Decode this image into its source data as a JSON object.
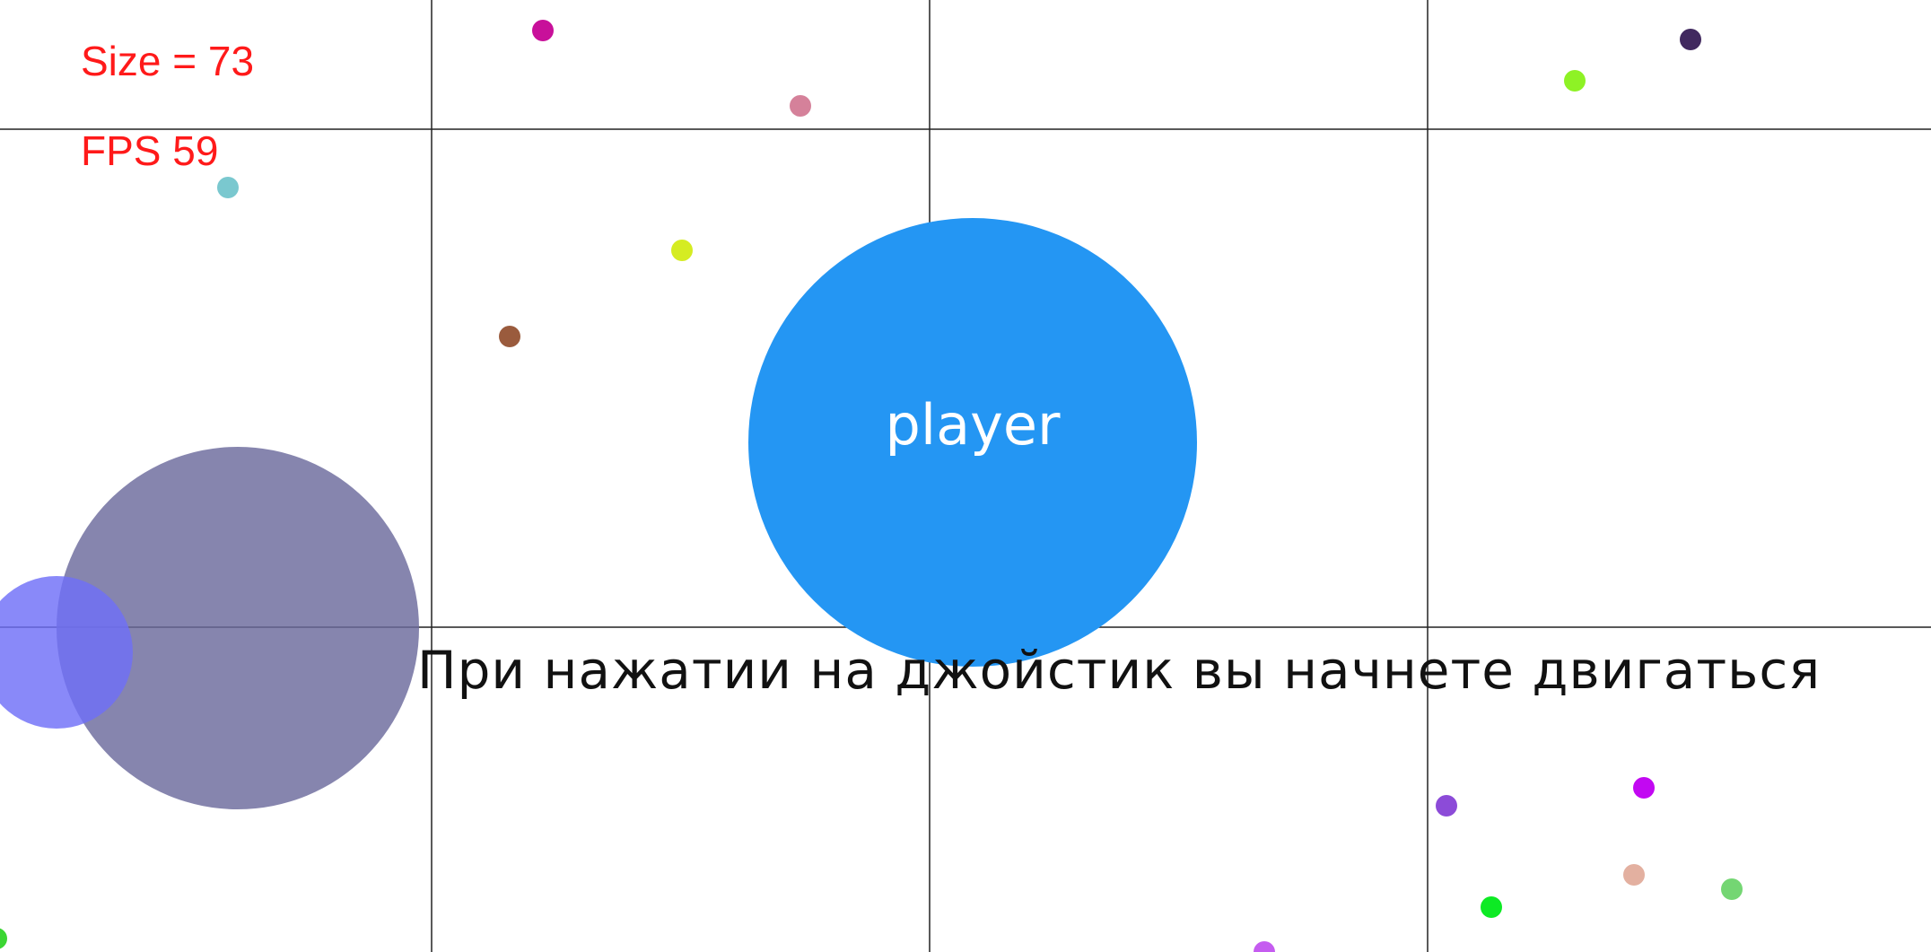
{
  "hud": {
    "size_text": "Size = 73",
    "fps_text": "FPS  59"
  },
  "player": {
    "label": "player",
    "color": "#2496f3",
    "label_color": "#ffffff"
  },
  "hint": {
    "text": "При нажатии на джойстик вы начнете двигаться"
  },
  "colors": {
    "background": "#ffffff",
    "grid_line": "#222222",
    "hud_text": "#ff1a1a",
    "enemy_large": "#6b6a9c",
    "enemy_small": "#6f6ff8"
  },
  "food_colors": [
    "#c8109a",
    "#d5819a",
    "#41295f",
    "#8ef225",
    "#7ac8cf",
    "#d5ec22",
    "#9a5b3d",
    "#8c4bd8",
    "#c208f2",
    "#e3b0a0",
    "#0dea24",
    "#74d673",
    "#c55cf0",
    "#3bd633"
  ]
}
